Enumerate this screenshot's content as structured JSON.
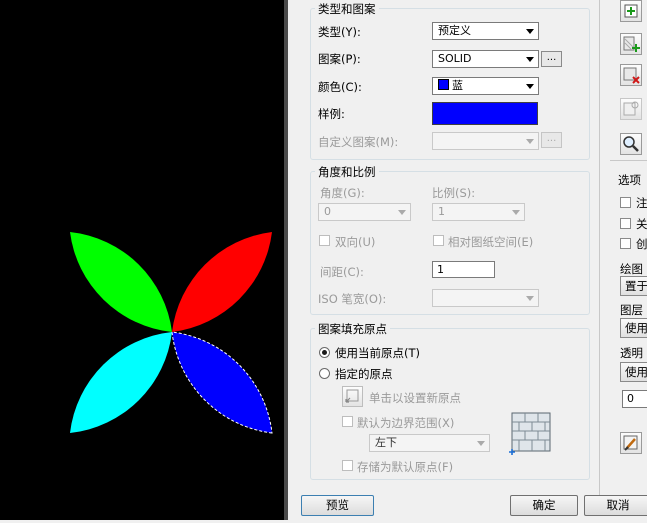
{
  "pattern_group": {
    "title": "类型和图案",
    "type_label": "类型(Y):",
    "type_value": "预定义",
    "pattern_label": "图案(P):",
    "pattern_value": "SOLID",
    "color_label": "颜色(C):",
    "color_value": "蓝",
    "swatch_label": "样例:",
    "custom_label": "自定义图案(M):",
    "browse_label": "...",
    "colors": {
      "selected": "#0000ff"
    }
  },
  "angle_group": {
    "title": "角度和比例",
    "angle_label": "角度(G):",
    "angle_value": "0",
    "scale_label": "比例(S):",
    "scale_value": "1",
    "double_label": "双向(U)",
    "relative_label": "相对图纸空间(E)",
    "spacing_label": "间距(C):",
    "spacing_value": "1",
    "iso_label": "ISO 笔宽(O):"
  },
  "origin_group": {
    "title": "图案填充原点",
    "current_label": "使用当前原点(T)",
    "specified_label": "指定的原点",
    "click_label": "单击以设置新原点",
    "boundary_label": "默认为边界范围(X)",
    "position_value": "左下",
    "store_label": "存储为默认原点(F)"
  },
  "right_panel": {
    "options_title": "选项",
    "opt1": "注",
    "opt2": "关",
    "opt3": "创",
    "draw_order_label": "绘图",
    "draw_order_value": "置于",
    "layer_label": "图层",
    "layer_value": "使用",
    "transparency_label": "透明",
    "transparency_value": "使用",
    "transparency_number": "0"
  },
  "buttons": {
    "preview": "预览",
    "ok": "确定",
    "cancel": "取消"
  },
  "petal_colors": {
    "top_left": "#00ff00",
    "top_right": "#ff0000",
    "bottom_left": "#00ffff",
    "bottom_right": "#0000ff"
  }
}
